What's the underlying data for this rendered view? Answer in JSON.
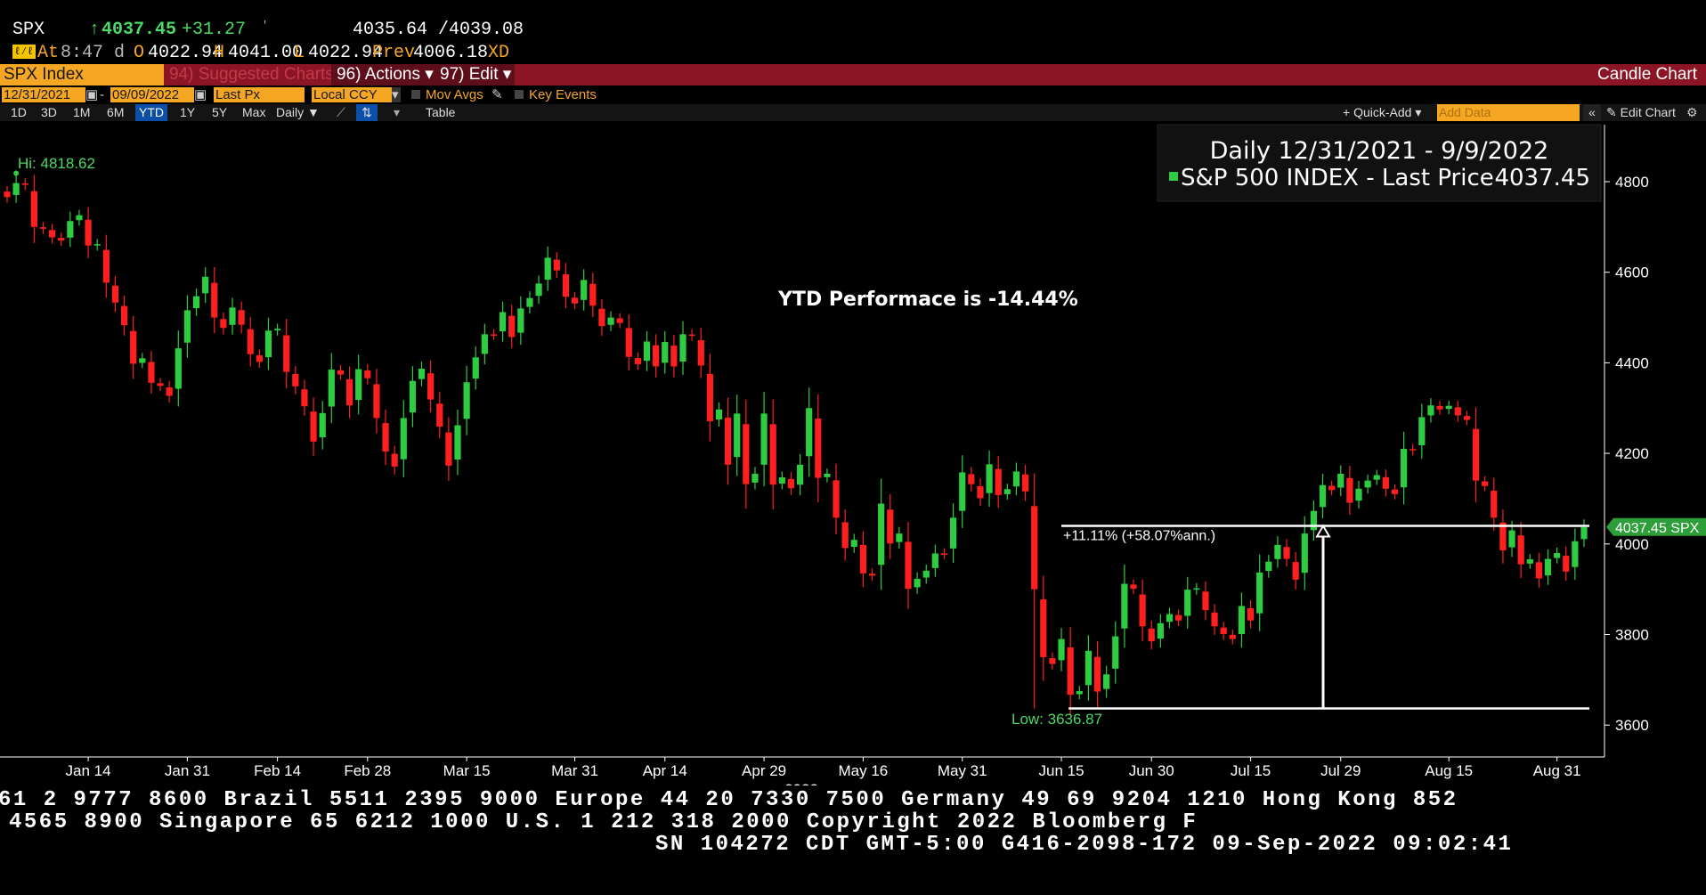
{
  "header": {
    "ticker": "SPX",
    "arrow": "↑",
    "last": "4037.45",
    "change": "+31.27",
    "dot": "'",
    "bid_ask": "4035.64 /4039.08",
    "icon_text": "ℓ⁄ℓ",
    "at_label": "At",
    "time": "8:47 d",
    "open_label": "O",
    "open": "4022.94",
    "high_label": "H",
    "high": "4041.00",
    "low_label": "L",
    "low": "4022.94",
    "prev_label": "Prev",
    "prev": "4006.18",
    "xd": "XD"
  },
  "toolbar": {
    "security": "SPX Index",
    "suggested": "94) Suggested Charts",
    "actions": "96) Actions ▾",
    "edit": "97) Edit ▾",
    "chart_type": "Candle Chart",
    "start_date": "12/31/2021",
    "end_date": "09/09/2022",
    "field": "Last Px",
    "currency": "Local CCY",
    "mov_avgs": "Mov Avgs",
    "key_events": "Key Events",
    "ranges": [
      "1D",
      "3D",
      "1M",
      "6M",
      "YTD",
      "1Y",
      "5Y",
      "Max"
    ],
    "active_range": "YTD",
    "freq": "Daily ▼",
    "table": "Table",
    "quick_add": "+ Quick-Add ▾",
    "add_data_placeholder": "Add Data",
    "collapse": "«",
    "edit_chart": "✎ Edit Chart",
    "settings_icon": "gear-icon"
  },
  "footer": {
    "line1": "61 2 9777 8600 Brazil 5511 2395 9000 Europe 44 20 7330 7500 Germany 49 69 9204 1210 Hong Kong 852",
    "line2": "4565 8900       Singapore 65 6212 1000       U.S. 1 212 318 2000       Copyright 2022 Bloomberg F",
    "line3": "SN 104272 CDT  GMT-5:00 G416-2098-172 09-Sep-2022 09:02:41"
  },
  "chart_data": {
    "type": "candlestick",
    "title": "Daily 12/31/2021 - 9/9/2022",
    "legend": [
      {
        "name": "S&P 500 INDEX - Last Price",
        "value": "4037.45",
        "color": "#2ecc40"
      }
    ],
    "annotation": "YTD Performace is -14.44%",
    "hi_label": "Hi: 4818.62",
    "low_label": "Low: 3636.87",
    "measure_label": "+11.11% (+58.07%ann.)",
    "measure": {
      "from_date": "2022-06-17",
      "from_price": 3636.87,
      "to_price": 4040.0,
      "end_date": "2022-09-09"
    },
    "last_tag": "4037.45 SPX",
    "last_price": 4037.45,
    "ylim": [
      3480,
      4900
    ],
    "y_ticks": [
      3600,
      3800,
      4000,
      4200,
      4400,
      4600,
      4800
    ],
    "x_tick_labels": [
      "Jan 14",
      "Jan 31",
      "Feb 14",
      "Feb 28",
      "Mar 15",
      "Mar 31",
      "Apr 14",
      "Apr 29",
      "May 16",
      "May 31",
      "Jun 15",
      "Jun 30",
      "Jul 15",
      "Jul 29",
      "Aug 15",
      "Aug 31"
    ],
    "x_tick_days": [
      9,
      20,
      30,
      40,
      51,
      63,
      73,
      84,
      95,
      106,
      117,
      127,
      138,
      148,
      160,
      172
    ],
    "x_year_label": "2022",
    "up_color": "#2ecc40",
    "down_color": "#ff1f1f",
    "closes": [
      4766,
      4797,
      4793,
      4700,
      4696,
      4677,
      4670,
      4713,
      4726,
      4659,
      4662,
      4577,
      4533,
      4483,
      4398,
      4410,
      4356,
      4349,
      4327,
      4432,
      4516,
      4547,
      4590,
      4500,
      4477,
      4522,
      4484,
      4419,
      4402,
      4471,
      4475,
      4380,
      4348,
      4304,
      4226,
      4289,
      4385,
      4374,
      4306,
      4386,
      4366,
      4278,
      4204,
      4171,
      4278,
      4360,
      4387,
      4319,
      4259,
      4173,
      4262,
      4357,
      4412,
      4463,
      4462,
      4512,
      4457,
      4520,
      4543,
      4575,
      4632,
      4604,
      4546,
      4531,
      4583,
      4526,
      4481,
      4500,
      4488,
      4413,
      4397,
      4447,
      4392,
      4446,
      4392,
      4463,
      4460,
      4394,
      4271,
      4297,
      4175,
      4288,
      4132,
      4155,
      4288,
      4131,
      4147,
      4123,
      4175,
      4300,
      4146,
      4155,
      4058,
      3991,
      4009,
      3935,
      3930,
      4089,
      4001,
      4023,
      3901,
      3923,
      3941,
      3979,
      3978,
      4058,
      4158,
      4132,
      4101,
      4176,
      4108,
      4121,
      4160,
      4116,
      3900,
      3750,
      3735,
      3790,
      3667,
      3675,
      3764,
      3674,
      3712,
      3796,
      3912,
      3901,
      3818,
      3785,
      3825,
      3845,
      3831,
      3899,
      3902,
      3854,
      3818,
      3801,
      3790,
      3863,
      3831,
      3937,
      3961,
      3998,
      3967,
      3921,
      4023,
      4073,
      4130,
      4119,
      4155,
      4091,
      4122,
      4140,
      4152,
      4122,
      4110,
      4210,
      4207,
      4280,
      4306,
      4297,
      4305,
      4284,
      4274,
      4140,
      4128,
      4058,
      3986,
      4030,
      3955,
      3966,
      3924,
      3967,
      3980,
      3939,
      4006,
      4037
    ]
  }
}
